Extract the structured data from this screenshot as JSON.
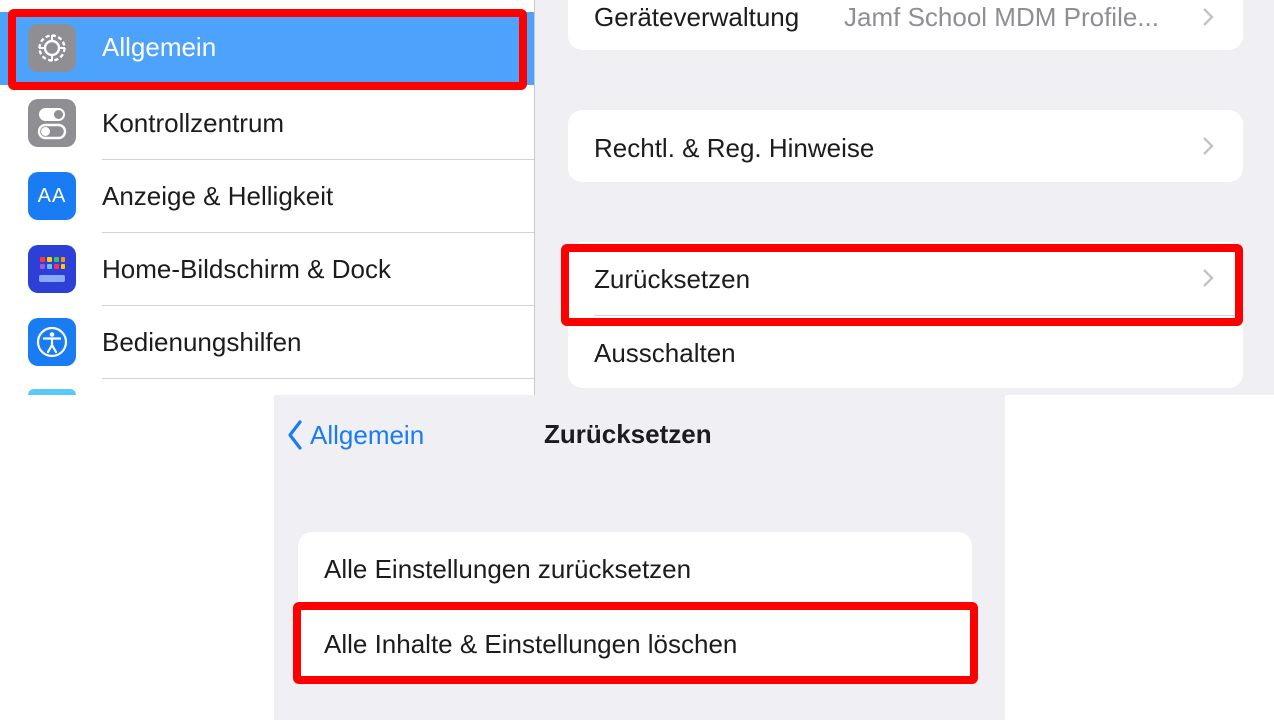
{
  "sidebar": {
    "items": [
      {
        "label": "Allgemein",
        "icon": "gear-icon",
        "selected": true
      },
      {
        "label": "Kontrollzentrum",
        "icon": "toggles-icon"
      },
      {
        "label": "Anzeige & Helligkeit",
        "icon": "text-size-icon",
        "icon_text": "AA"
      },
      {
        "label": "Home-Bildschirm & Dock",
        "icon": "app-grid-icon"
      },
      {
        "label": "Bedienungshilfen",
        "icon": "accessibility-icon"
      }
    ]
  },
  "detail": {
    "device_management": {
      "label": "Geräteverwaltung",
      "value": "Jamf School MDM Profile..."
    },
    "legal": {
      "label": "Rechtl. & Reg. Hinweise"
    },
    "reset": {
      "label": "Zurücksetzen"
    },
    "shutdown": {
      "label": "Ausschalten"
    }
  },
  "reset_screen": {
    "back_label": "Allgemein",
    "title": "Zurücksetzen",
    "options": [
      {
        "label": "Alle Einstellungen zurücksetzen"
      },
      {
        "label": "Alle Inhalte & Einstellungen löschen"
      }
    ]
  },
  "colors": {
    "highlight": "#ff0000",
    "selection": "#4da2fb",
    "link_blue": "#1a7cf3",
    "grouped_background": "#efeff4"
  }
}
